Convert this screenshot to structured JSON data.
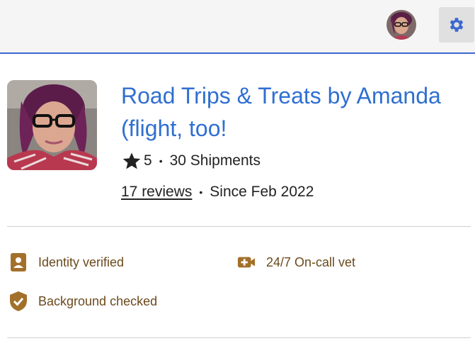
{
  "header": {
    "avatar_icon": "user-avatar-photo",
    "settings_icon": "gear-icon",
    "accent_color": "#3b67d0"
  },
  "profile": {
    "title": "Road Trips & Treats by Amanda (flight, too!",
    "rating": "5",
    "shipments": "30 Shipments",
    "reviews": "17 reviews",
    "since": "Since Feb 2022",
    "bullet": "•",
    "title_color": "#2f6fd1"
  },
  "features": [
    {
      "icon": "identity-card-icon",
      "label": "Identity verified"
    },
    {
      "icon": "video-plus-icon",
      "label": "24/7 On-call vet"
    },
    {
      "icon": "shield-check-icon",
      "label": "Background checked"
    }
  ],
  "feature_color": "#a3702a"
}
